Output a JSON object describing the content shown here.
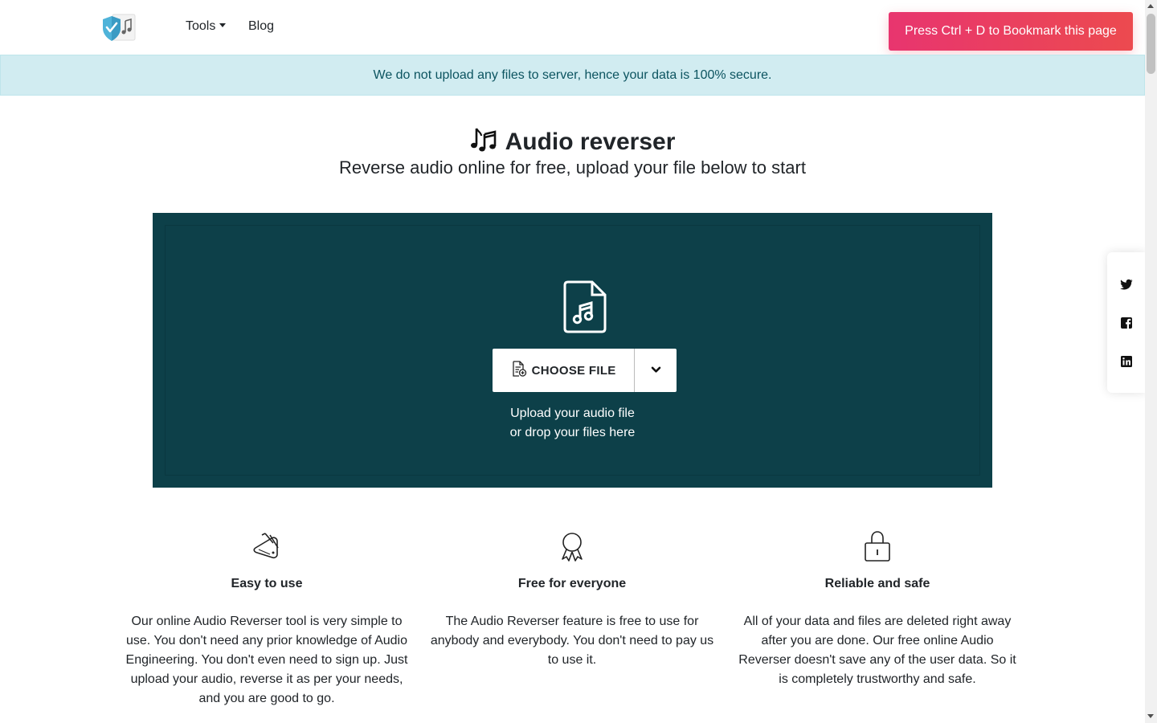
{
  "nav": {
    "logo_icon": "shield-music-logo-icon",
    "tools_label": "Tools",
    "blog_label": "Blog",
    "bookmark_label": "Press Ctrl + D to Bookmark this page"
  },
  "alert": {
    "text": "We do not upload any files to server, hence your data is 100% secure."
  },
  "hero": {
    "title_icon": "music-notes-icon",
    "title": "Audio reverser",
    "subtitle": "Reverse audio online for free, upload your file below to start"
  },
  "upload": {
    "file_icon": "music-file-icon",
    "choose_label": "CHOOSE FILE",
    "dropdown_icon": "chevron-down-icon",
    "line1": "Upload your audio file",
    "line2": "or drop your files here",
    "bg_color": "#0d4049"
  },
  "features": [
    {
      "icon": "swiss-knife-icon",
      "title": "Easy to use",
      "text": "Our online Audio Reverser tool is very simple to use. You don't need any prior knowledge of Audio Engineering. You don't even need to sign up. Just upload your audio, reverse it as per your needs, and you are good to go."
    },
    {
      "icon": "award-ribbon-icon",
      "title": "Free for everyone",
      "text": "The Audio Reverser feature is free to use for anybody and everybody. You don't need to pay us to use it."
    },
    {
      "icon": "lock-icon",
      "title": "Reliable and safe",
      "text": "All of your data and files are deleted right away after you are done. Our free online Audio Reverser doesn't save any of the user data. So it is completely trustworthy and safe."
    }
  ],
  "share": [
    "twitter-icon",
    "facebook-icon",
    "linkedin-icon"
  ],
  "colors": {
    "bookmark_start": "#e8356f",
    "bookmark_end": "#ec4a4f",
    "alert_bg": "#d1ecf1",
    "alert_text": "#0c5460"
  }
}
